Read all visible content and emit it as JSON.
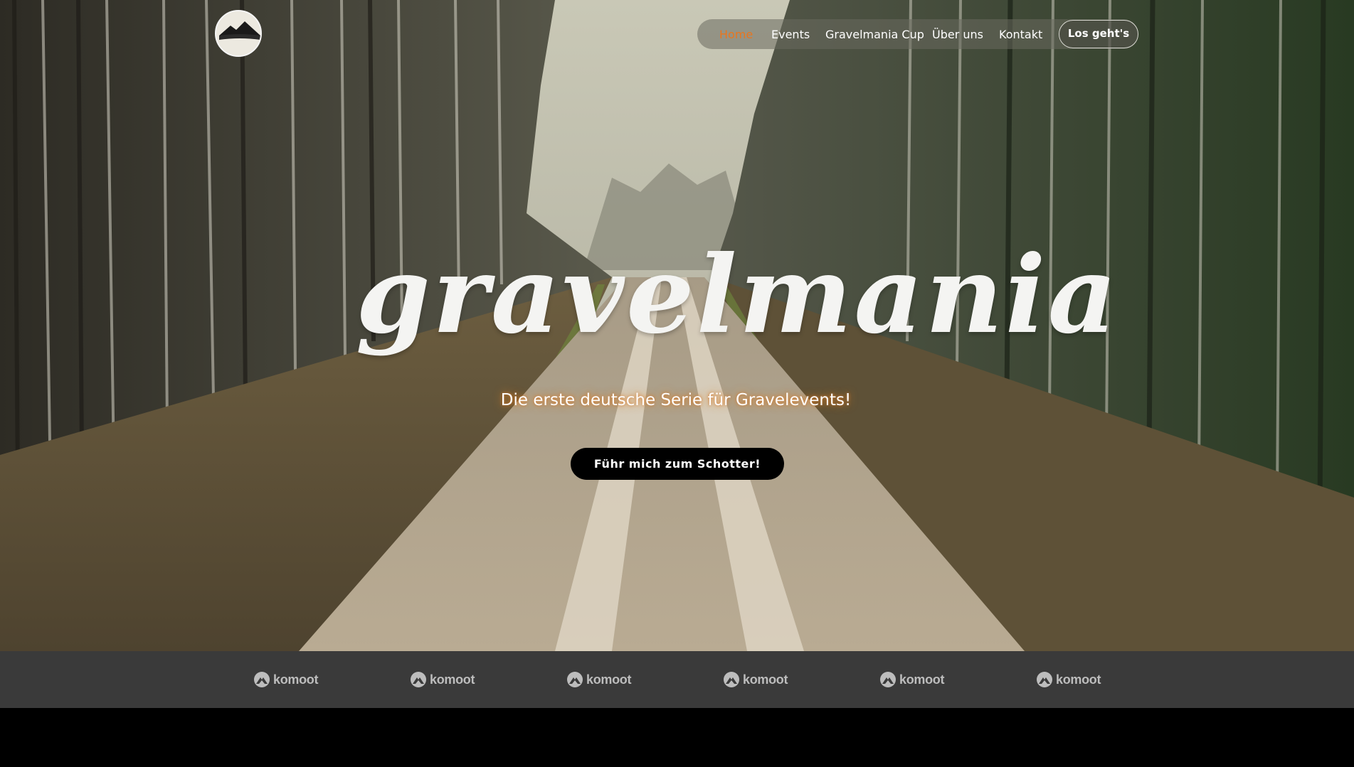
{
  "nav": {
    "logo_icon": "mountain-circle-logo",
    "items": [
      {
        "label": "Home",
        "active": true
      },
      {
        "label": "Events",
        "active": false
      },
      {
        "label": "Gravelmania Cup",
        "active": false
      },
      {
        "label": "Über uns",
        "active": false
      },
      {
        "label": "Kontakt",
        "active": false
      }
    ],
    "cta_label": "Los geht's"
  },
  "hero": {
    "brand": "gravelmania",
    "tagline": "Die erste deutsche Serie für Gravelevents!",
    "cta_label": "Führ mich zum Schotter!",
    "background": "forest-gravel-road-photo"
  },
  "sponsors": {
    "icon": "komoot-icon",
    "items": [
      "komoot",
      "komoot",
      "komoot",
      "komoot",
      "komoot",
      "komoot"
    ]
  },
  "colors": {
    "accent": "#e8761f",
    "strip": "#3a3a3a",
    "button": "#000000"
  }
}
